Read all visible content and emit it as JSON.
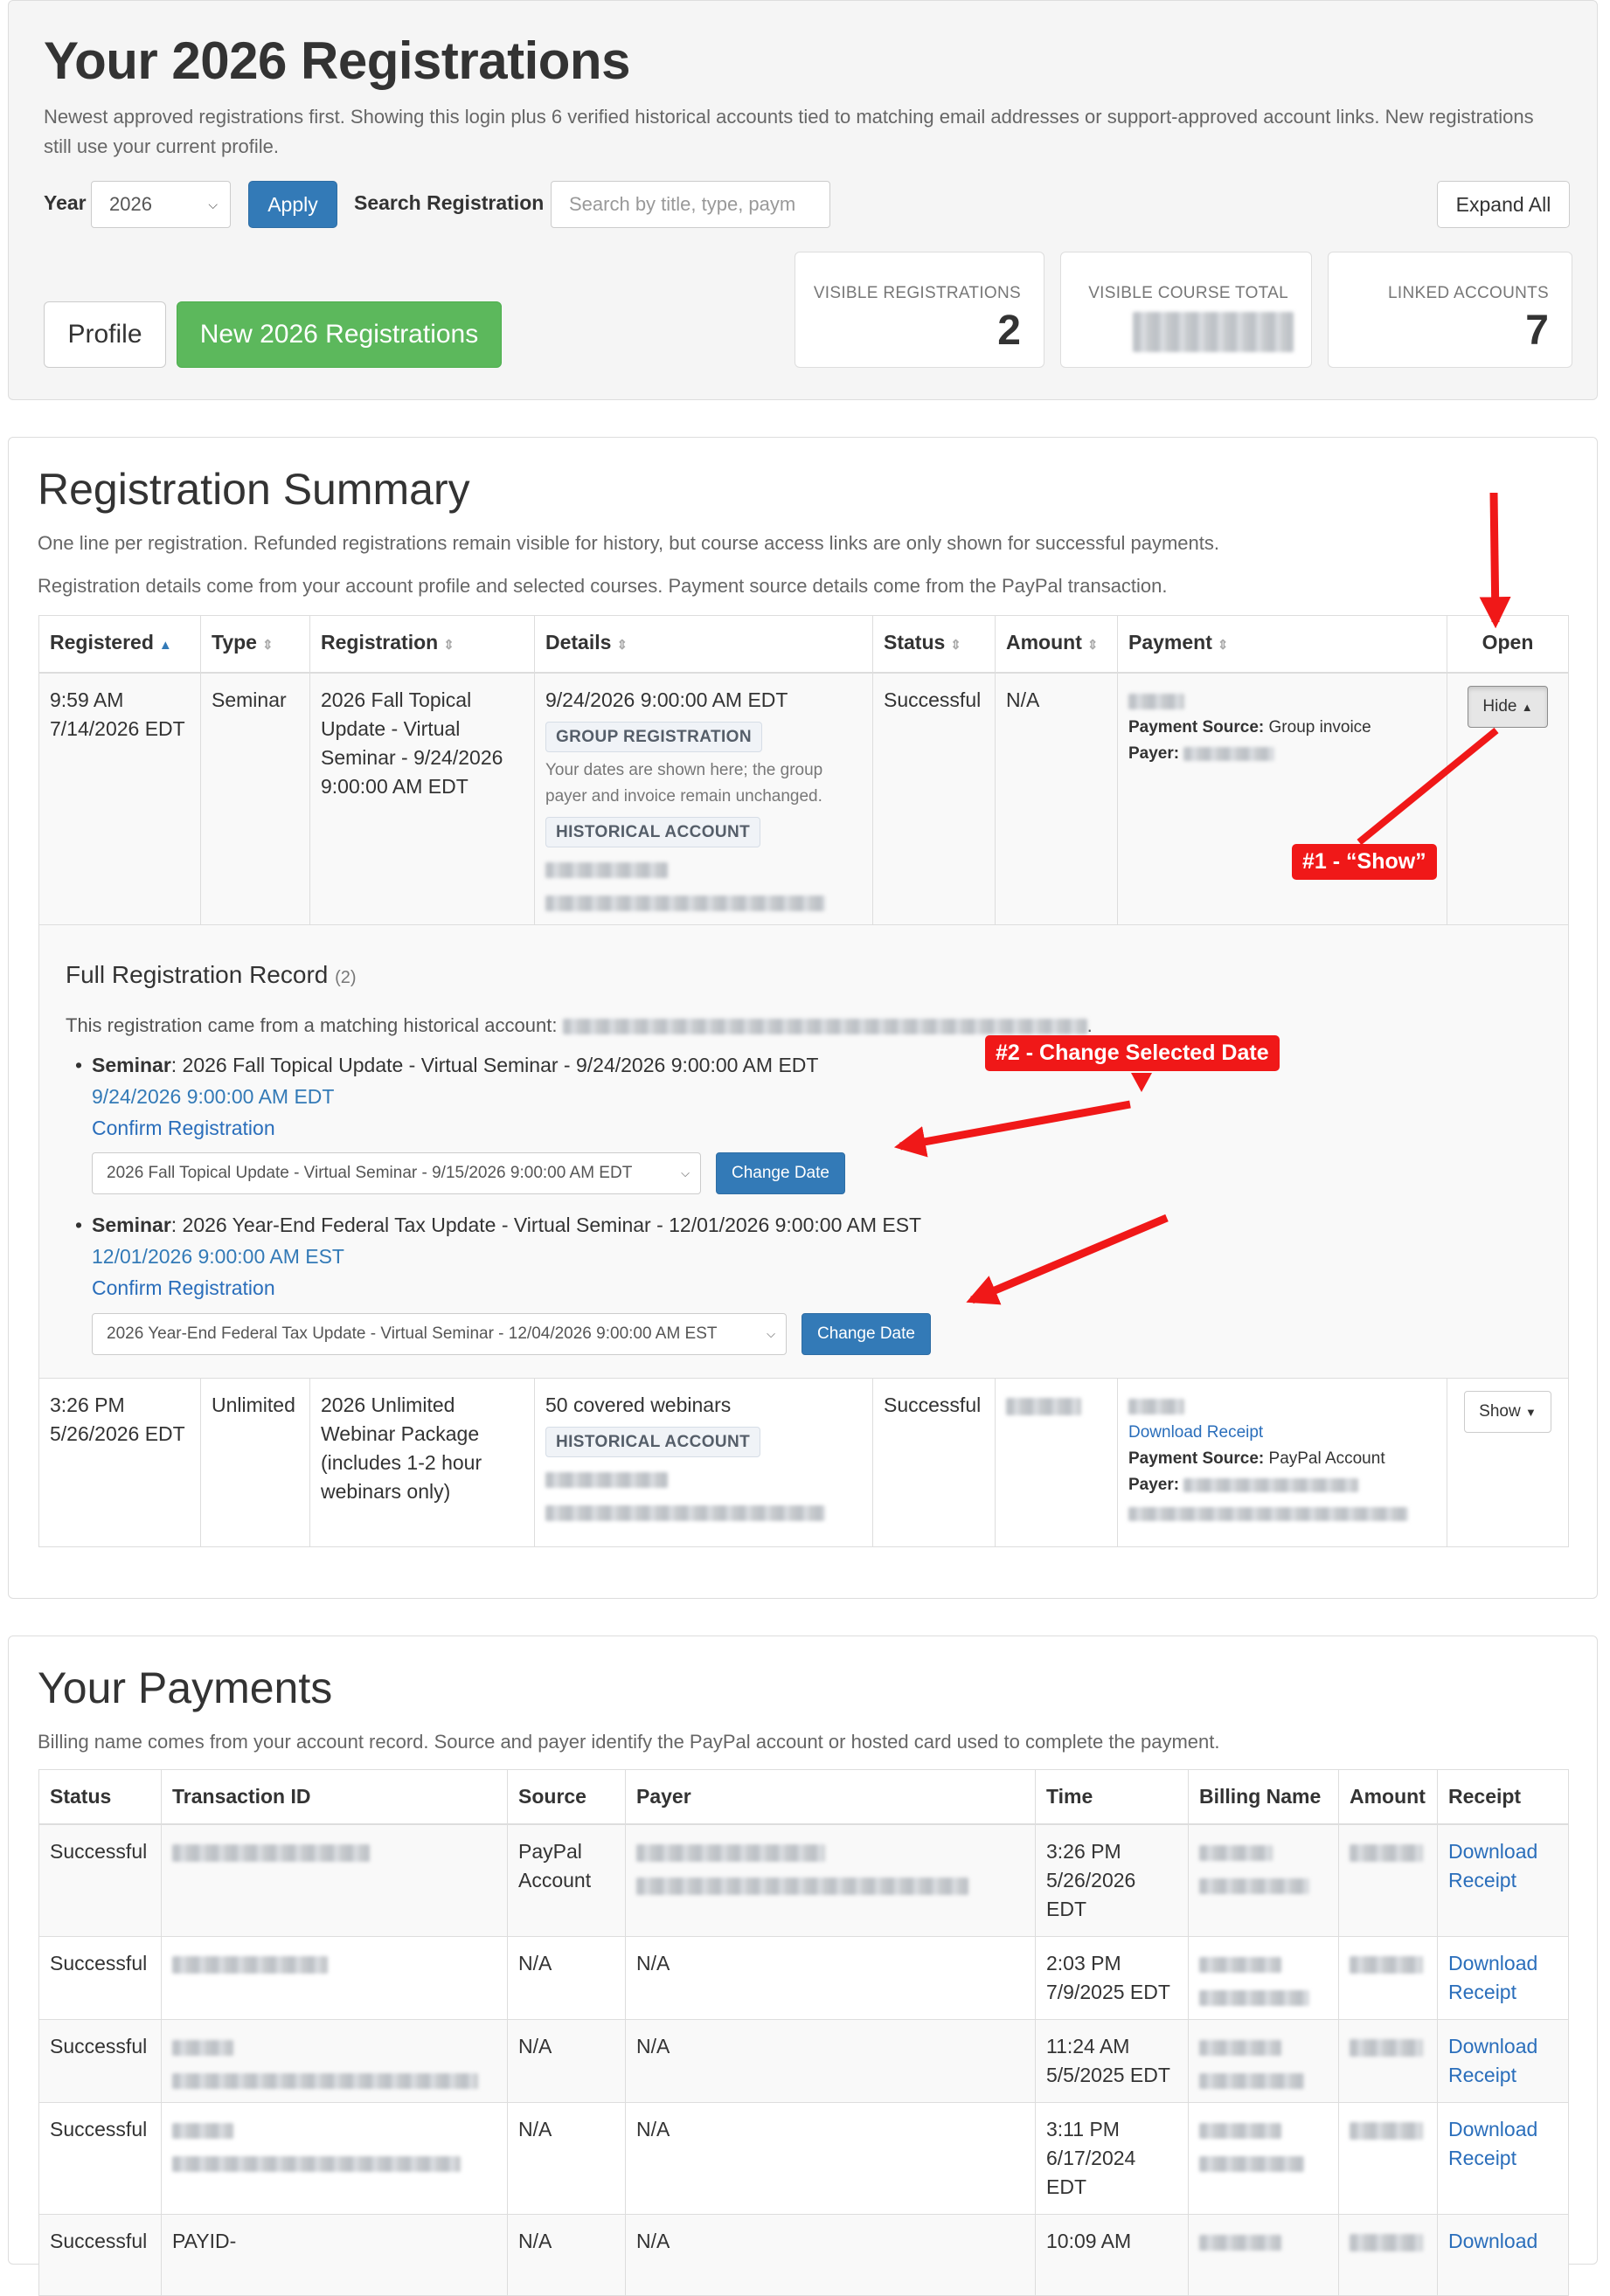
{
  "header": {
    "title": "Your 2026 Registrations",
    "intro": "Newest approved registrations first. Showing this login plus 6 verified historical accounts tied to matching email addresses or support-approved account links. New registrations still use your current profile.",
    "year_label": "Year",
    "year_value": "2026",
    "apply_label": "Apply",
    "search_label": "Search Registration",
    "search_placeholder": "Search by title, type, paym",
    "expand_all_label": "Expand All",
    "profile_label": "Profile",
    "new_registrations_label": "New 2026 Registrations"
  },
  "stats": [
    {
      "label": "VISIBLE REGISTRATIONS",
      "value": "2"
    },
    {
      "label": "VISIBLE COURSE TOTAL",
      "value": ""
    },
    {
      "label": "LINKED ACCOUNTS",
      "value": "7"
    }
  ],
  "summary": {
    "title": "Registration Summary",
    "note1": "One line per registration. Refunded registrations remain visible for history, but course access links are only shown for successful payments.",
    "note2": "Registration details come from your account profile and selected courses. Payment source details come from the PayPal transaction.",
    "columns": [
      "Registered",
      "Type",
      "Registration",
      "Details",
      "Status",
      "Amount",
      "Payment",
      "Open"
    ],
    "rows": [
      {
        "time": "9:59 AM",
        "date": "7/14/2026 EDT",
        "type": "Seminar",
        "registration": "2026 Fall Topical Update - Virtual Seminar - 9/24/2026 9:00:00 AM EDT",
        "details_date": "9/24/2026 9:00:00 AM EDT",
        "tag1": "GROUP REGISTRATION",
        "details_note": "Your dates are shown here; the group payer and invoice remain unchanged.",
        "tag2": "HISTORICAL ACCOUNT",
        "status": "Successful",
        "amount": "N/A",
        "payment_source_label": "Payment Source:",
        "payment_source": "Group invoice",
        "payer_label": "Payer:",
        "open_label": "Hide"
      },
      {
        "time": "3:26 PM",
        "date": "5/26/2026 EDT",
        "type": "Unlimited",
        "registration": "2026 Unlimited Webinar Package (includes 1-2 hour webinars only)",
        "details_text": "50 covered webinars",
        "tag": "HISTORICAL ACCOUNT",
        "status": "Successful",
        "download_receipt": "Download Receipt",
        "payment_source_label": "Payment Source:",
        "payment_source": "PayPal Account",
        "payer_label": "Payer:",
        "open_label": "Show"
      }
    ],
    "record": {
      "title": "Full Registration Record",
      "count": "(2)",
      "note": "This registration came from a matching historical account:",
      "items": [
        {
          "kind": "Seminar",
          "title": ": 2026 Fall Topical Update - Virtual Seminar - 9/24/2026 9:00:00 AM EDT",
          "date": "9/24/2026 9:00:00 AM EDT",
          "confirm": "Confirm Registration",
          "select": "2026 Fall Topical Update - Virtual Seminar - 9/15/2026 9:00:00 AM EDT",
          "change": "Change Date"
        },
        {
          "kind": "Seminar",
          "title": ": 2026 Year-End Federal Tax Update - Virtual Seminar - 12/01/2026 9:00:00 AM EST",
          "date": "12/01/2026 9:00:00 AM EST",
          "confirm": "Confirm Registration",
          "select": "2026 Year-End Federal Tax Update - Virtual Seminar - 12/04/2026 9:00:00 AM EST",
          "change": "Change Date"
        }
      ]
    }
  },
  "annotations": {
    "callout1": "#1 - “Show”",
    "callout2": "#2 - Change Selected Date",
    "color": "#f01818"
  },
  "payments": {
    "title": "Your Payments",
    "note": "Billing name comes from your account record. Source and payer identify the PayPal account or hosted card used to complete the payment.",
    "columns": [
      "Status",
      "Transaction ID",
      "Source",
      "Payer",
      "Time",
      "Billing Name",
      "Amount",
      "Receipt"
    ],
    "rows": [
      {
        "status": "Successful",
        "source": "PayPal Account",
        "payer": "",
        "time": "3:26 PM 5/26/2026 EDT",
        "receipt": "Download Receipt"
      },
      {
        "status": "Successful",
        "source": "N/A",
        "payer": "N/A",
        "time": "2:03 PM 7/9/2025 EDT",
        "receipt": "Download Receipt"
      },
      {
        "status": "Successful",
        "source": "N/A",
        "payer": "N/A",
        "time": "11:24 AM 5/5/2025 EDT",
        "receipt": "Download Receipt"
      },
      {
        "status": "Successful",
        "source": "N/A",
        "payer": "N/A",
        "time": "3:11 PM 6/17/2024 EDT",
        "receipt": "Download Receipt"
      },
      {
        "status": "Successful",
        "txn": "PAYID-",
        "source": "N/A",
        "payer": "N/A",
        "time": "10:09 AM",
        "receipt": "Download"
      }
    ]
  },
  "colors": {
    "primary": "#337ab7",
    "success": "#5cb85c",
    "link": "#2a6ebb",
    "annotation": "#f01818"
  }
}
